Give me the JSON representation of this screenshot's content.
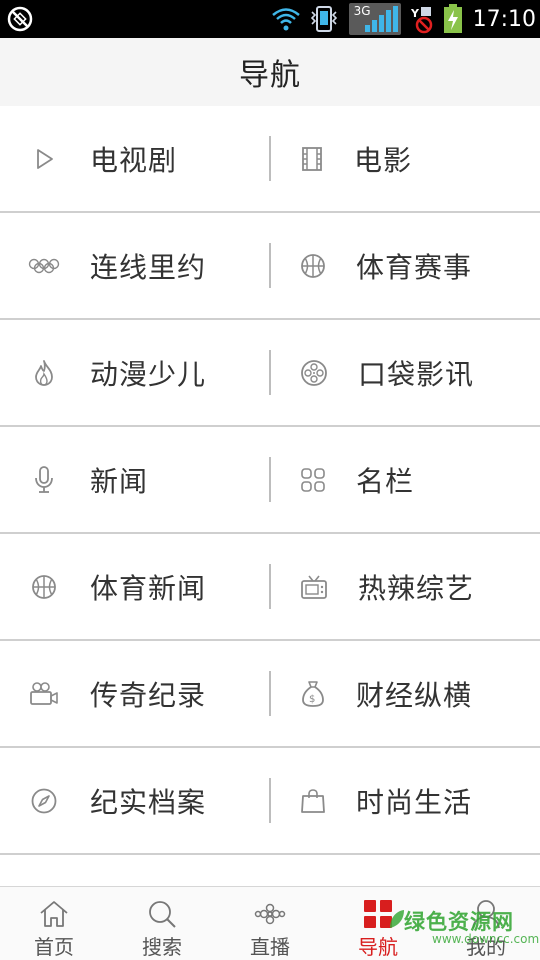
{
  "status_bar": {
    "network": "3G",
    "time": "17:10"
  },
  "header": {
    "title": "导航"
  },
  "nav_rows": [
    {
      "left": {
        "label": "电视剧",
        "icon": "play-icon"
      },
      "right": {
        "label": "电影",
        "icon": "film-icon"
      }
    },
    {
      "left": {
        "label": "连线里约",
        "icon": "olympic-rings-icon"
      },
      "right": {
        "label": "体育赛事",
        "icon": "basketball-icon"
      }
    },
    {
      "left": {
        "label": "动漫少儿",
        "icon": "flame-icon"
      },
      "right": {
        "label": "口袋影讯",
        "icon": "film-reel-icon"
      }
    },
    {
      "left": {
        "label": "新闻",
        "icon": "microphone-icon"
      },
      "right": {
        "label": "名栏",
        "icon": "grid-icon"
      }
    },
    {
      "left": {
        "label": "体育新闻",
        "icon": "basketball-icon"
      },
      "right": {
        "label": "热辣综艺",
        "icon": "tv-icon"
      }
    },
    {
      "left": {
        "label": "传奇纪录",
        "icon": "video-camera-icon"
      },
      "right": {
        "label": "财经纵横",
        "icon": "money-bag-icon"
      }
    },
    {
      "left": {
        "label": "纪实档案",
        "icon": "compass-icon"
      },
      "right": {
        "label": "时尚生活",
        "icon": "shopping-bag-icon"
      }
    }
  ],
  "tabs": [
    {
      "label": "首页",
      "icon": "home-icon"
    },
    {
      "label": "搜索",
      "icon": "search-icon"
    },
    {
      "label": "直播",
      "icon": "live-knot-icon"
    },
    {
      "label": "导航",
      "icon": "nav-grid-icon",
      "active": true
    },
    {
      "label": "我的",
      "icon": "user-icon"
    }
  ],
  "watermark": {
    "text": "绿色资源网",
    "url_text": "www.downcc.com"
  },
  "colors": {
    "accent": "#d81e1e",
    "icon_gray": "#8a8a8a",
    "watermark_green": "#3aa93a"
  }
}
